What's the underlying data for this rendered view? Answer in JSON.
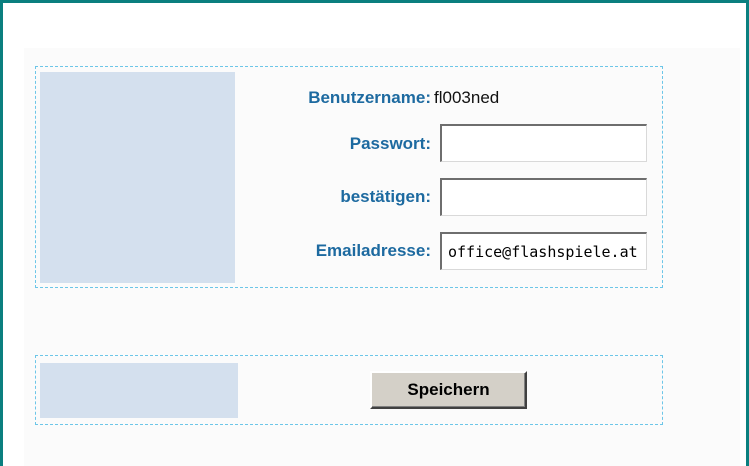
{
  "form": {
    "username_label": "Benutzername:",
    "username_value": "fl003ned",
    "password_label": "Passwort:",
    "password_value": "",
    "confirm_label": "bestätigen:",
    "confirm_value": "",
    "email_label": "Emailadresse:",
    "email_value": "office@flashspiele.at"
  },
  "actions": {
    "save_label": "Speichern"
  },
  "colors": {
    "frame_border": "#0a7f7f",
    "label_text": "#1d6aa0",
    "dashed_border": "#6cc6e8",
    "sidebar_block": "#d4e0ee",
    "button_face": "#d4d0c8"
  }
}
